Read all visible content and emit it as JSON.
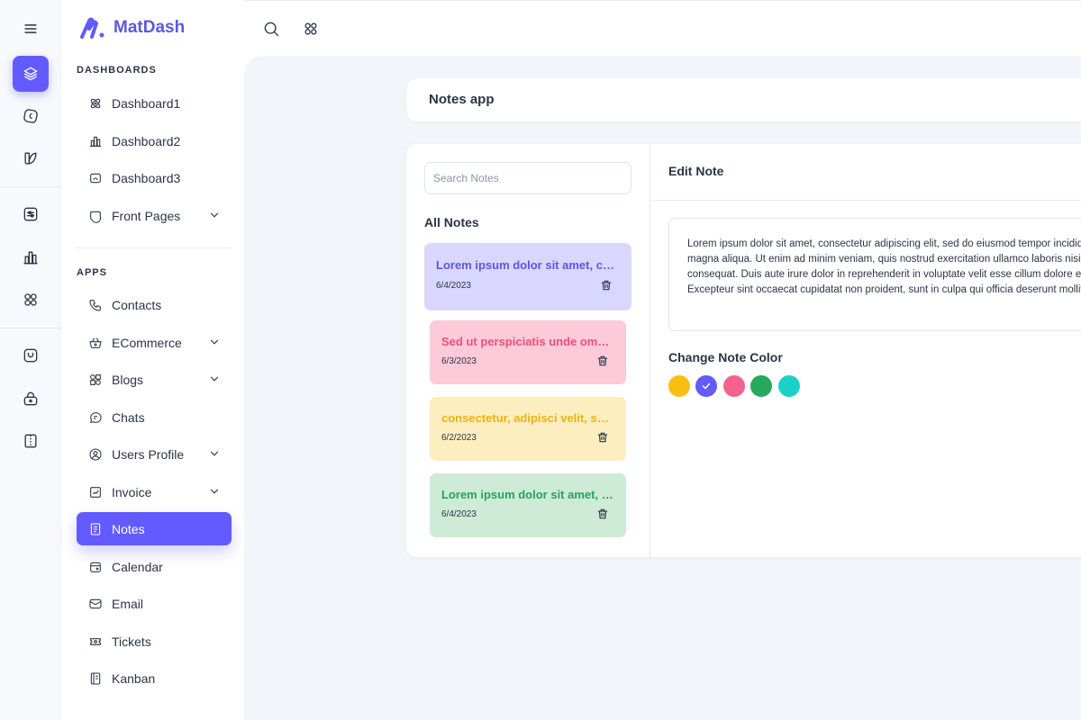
{
  "brand": {
    "name": "MatDash",
    "accent": "#635bff"
  },
  "rail": {
    "icons": [
      "layers-icon",
      "grid-coin-icon",
      "leaf-icon",
      "sliders-icon",
      "bar-chart-icon",
      "apps-icon",
      "mood-icon",
      "lock-icon",
      "layout-sidebar-icon"
    ]
  },
  "sidebar": {
    "dashboards_title": "DASHBOARDS",
    "dashboards": [
      {
        "label": "Dashboard1",
        "icon": "atom-icon"
      },
      {
        "label": "Dashboard2",
        "icon": "chart-bars-icon"
      },
      {
        "label": "Dashboard3",
        "icon": "screen-icon"
      },
      {
        "label": "Front Pages",
        "icon": "app-window-icon",
        "expandable": true
      }
    ],
    "apps_title": "APPS",
    "apps": [
      {
        "label": "Contacts",
        "icon": "phone-icon"
      },
      {
        "label": "ECommerce",
        "icon": "basket-icon",
        "expandable": true
      },
      {
        "label": "Blogs",
        "icon": "chart-donut-icon",
        "expandable": true
      },
      {
        "label": "Chats",
        "icon": "message-icon"
      },
      {
        "label": "Users Profile",
        "icon": "user-circle-icon",
        "expandable": true
      },
      {
        "label": "Invoice",
        "icon": "file-check-icon",
        "expandable": true
      },
      {
        "label": "Notes",
        "icon": "notes-icon",
        "active": true
      },
      {
        "label": "Calendar",
        "icon": "calendar-icon"
      },
      {
        "label": "Email",
        "icon": "mail-icon"
      },
      {
        "label": "Tickets",
        "icon": "ticket-icon"
      },
      {
        "label": "Kanban",
        "icon": "notebook-icon"
      }
    ]
  },
  "header": {
    "icons": [
      "search-icon",
      "apps-grid-icon"
    ]
  },
  "page": {
    "title": "Notes app"
  },
  "notes_panel": {
    "search_placeholder": "Search Notes",
    "all_notes_label": "All Notes",
    "notes": [
      {
        "title": "Lorem ipsum dolor sit amet, consectetur adipiscing elit",
        "date": "6/4/2023",
        "color": "primary",
        "bg": "#d9d6ff",
        "fg": "#5d57e0",
        "selected": true
      },
      {
        "title": "Sed ut perspiciatis unde omnis iste natus",
        "date": "6/3/2023",
        "color": "error",
        "bg": "#fccad8",
        "fg": "#ec4f7b"
      },
      {
        "title": "consectetur, adipisci velit, sed quia",
        "date": "6/2/2023",
        "color": "warning",
        "bg": "#fdeec0",
        "fg": "#e9b40c"
      },
      {
        "title": "Lorem ipsum dolor sit amet, consectetur",
        "date": "6/4/2023",
        "color": "success",
        "bg": "#cdebd7",
        "fg": "#25a35a"
      }
    ]
  },
  "editor": {
    "title": "Edit Note",
    "lines": [
      "Lorem ipsum dolor sit amet, consectetur adipiscing elit, sed do eiusmod tempor incididunt ut labore et dolore",
      "magna aliqua. Ut enim ad minim veniam, quis nostrud exercitation ullamco laboris nisi ut aliquip ex ea commodo",
      "consequat. Duis aute irure dolor in reprehenderit in voluptate velit esse cillum dolore eu fugiat nulla pariatur.",
      "Excepteur sint occaecat cupidatat non proident, sunt in culpa qui officia deserunt mollit anim id est laborum."
    ],
    "color_label": "Change Note Color",
    "colors": [
      {
        "name": "warning",
        "hex": "#f7c00f"
      },
      {
        "name": "primary",
        "hex": "#635bff",
        "selected": true
      },
      {
        "name": "error",
        "hex": "#f5638c"
      },
      {
        "name": "success",
        "hex": "#27a85c"
      },
      {
        "name": "info",
        "hex": "#1bd0c7"
      }
    ]
  }
}
